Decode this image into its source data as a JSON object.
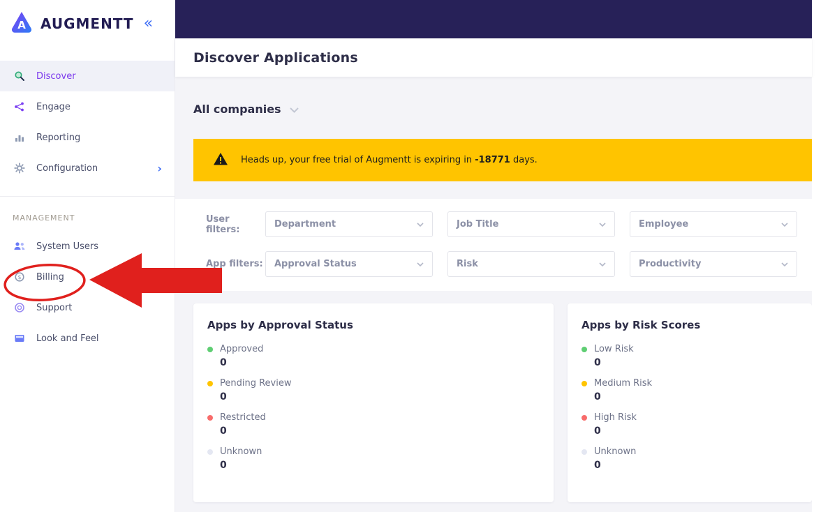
{
  "brand": {
    "name": "AUGMENTT"
  },
  "sidebar": {
    "items": [
      {
        "label": "Discover"
      },
      {
        "label": "Engage"
      },
      {
        "label": "Reporting"
      },
      {
        "label": "Configuration"
      }
    ],
    "section_label": "MANAGEMENT",
    "management_items": [
      {
        "label": "System Users"
      },
      {
        "label": "Billing"
      },
      {
        "label": "Support"
      },
      {
        "label": "Look and Feel"
      }
    ]
  },
  "header": {
    "title": "Discover Applications"
  },
  "toolbar": {
    "company_filter": "All companies"
  },
  "banner": {
    "text_before": "Heads up, your free trial of Augmentt is expiring in ",
    "days": "-18771",
    "text_after": " days."
  },
  "filters": {
    "user_label": "User filters:",
    "app_label": "App filters:",
    "user_selects": [
      {
        "placeholder": "Department"
      },
      {
        "placeholder": "Job Title"
      },
      {
        "placeholder": "Employee"
      }
    ],
    "app_selects": [
      {
        "placeholder": "Approval Status"
      },
      {
        "placeholder": "Risk"
      },
      {
        "placeholder": "Productivity"
      }
    ]
  },
  "cards": [
    {
      "title": "Apps by Approval Status",
      "items": [
        {
          "label": "Approved",
          "value": "0",
          "color": "#5fce73"
        },
        {
          "label": "Pending Review",
          "value": "0",
          "color": "#ffc400"
        },
        {
          "label": "Restricted",
          "value": "0",
          "color": "#f86c6b"
        },
        {
          "label": "Unknown",
          "value": "0",
          "color": "#e4e7f2"
        }
      ]
    },
    {
      "title": "Apps by Risk Scores",
      "items": [
        {
          "label": "Low Risk",
          "value": "0",
          "color": "#5fce73"
        },
        {
          "label": "Medium Risk",
          "value": "0",
          "color": "#ffc400"
        },
        {
          "label": "High Risk",
          "value": "0",
          "color": "#f86c6b"
        },
        {
          "label": "Unknown",
          "value": "0",
          "color": "#e4e7f2"
        }
      ]
    }
  ],
  "colors": {
    "topbar": "#272158",
    "banner_bg": "#ffc400",
    "accent": "#7c3aed",
    "annotation": "#e0201d"
  }
}
